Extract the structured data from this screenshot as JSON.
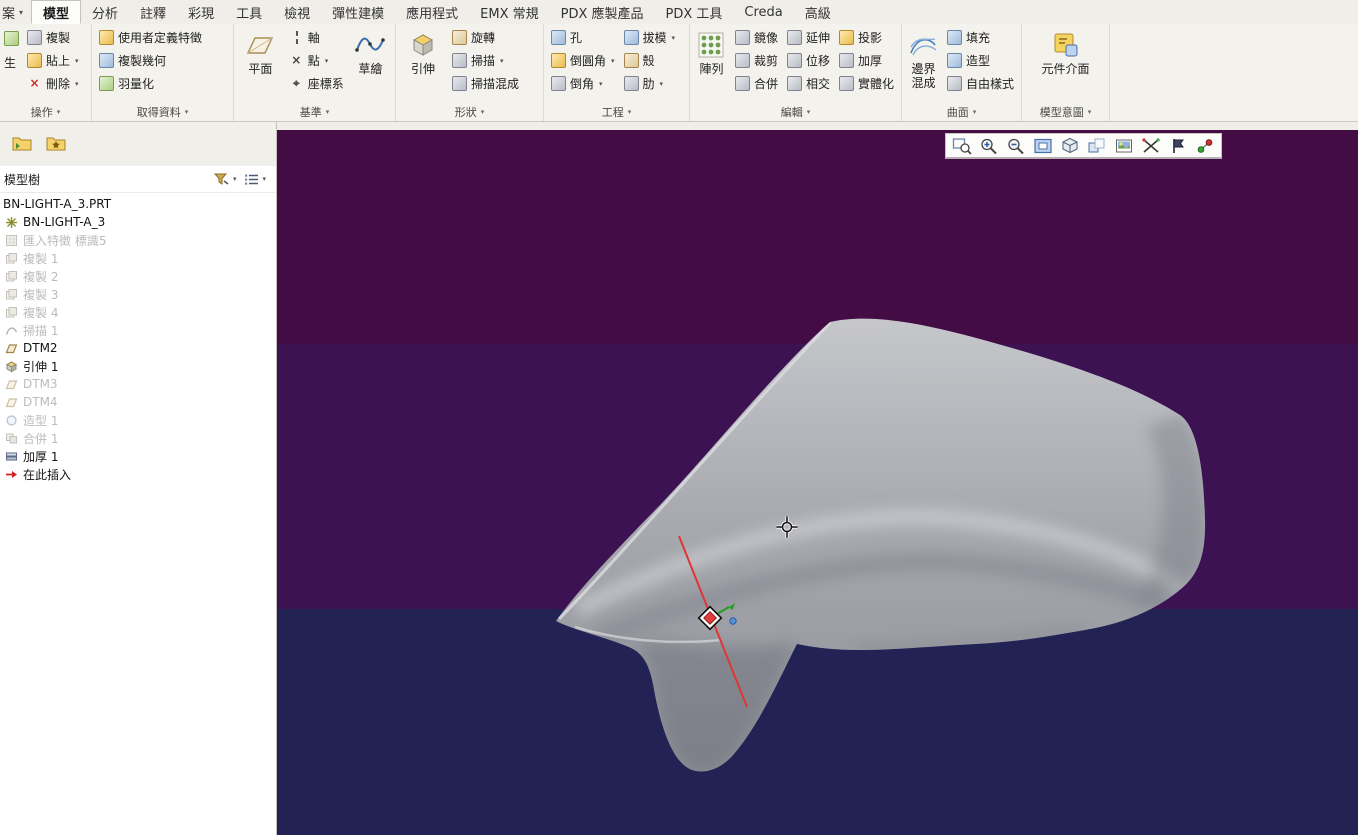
{
  "tabs": {
    "file": "案",
    "items": [
      "模型",
      "分析",
      "註釋",
      "彩現",
      "工具",
      "檢視",
      "彈性建模",
      "應用程式",
      "EMX 常規",
      "PDX 應製產品",
      "PDX 工具",
      "Creda",
      "高級"
    ],
    "selected": "模型"
  },
  "ribbon": {
    "operations": {
      "group": "操作",
      "regen_partial": "生",
      "copy": "複製",
      "paste": "貼上",
      "delete": "刪除"
    },
    "get_data": {
      "group": "取得資料",
      "udf": "使用者定義特徵",
      "copy_geometry": "複製幾何",
      "shrinkwrap": "羽量化"
    },
    "datum": {
      "group": "基準",
      "plane": "平面",
      "axis": "軸",
      "point": "點",
      "csys": "座標系",
      "sketch": "草繪"
    },
    "shapes": {
      "group": "形狀",
      "extrude": "引伸",
      "revolve": "旋轉",
      "sweep": "掃描",
      "swept_blend": "掃描混成"
    },
    "engineering": {
      "group": "工程",
      "hole": "孔",
      "round": "倒圓角",
      "chamfer": "倒角",
      "draft": "拔模",
      "shell": "殼",
      "rib": "肋"
    },
    "edit": {
      "group": "編輯",
      "pattern": "陣列",
      "mirror": "鏡像",
      "trim": "裁剪",
      "merge": "合併",
      "extend": "延伸",
      "offset": "位移",
      "intersect": "相交",
      "project": "投影",
      "thicken": "加厚",
      "solidify": "實體化"
    },
    "surfaces": {
      "group": "曲面",
      "boundary_blend": "邊界混成",
      "fill": "填充",
      "style": "造型",
      "freestyle": "自由樣式"
    },
    "model_intent": {
      "group": "模型意圖",
      "component_interface": "元件介面"
    }
  },
  "tree": {
    "title": "模型樹",
    "items": [
      {
        "label": "BN-LIGHT-A_3.PRT",
        "dim": false
      },
      {
        "label": "BN-LIGHT-A_3",
        "dim": false
      },
      {
        "label": "匯入特徵 標識5",
        "dim": true
      },
      {
        "label": "複製 1",
        "dim": true
      },
      {
        "label": "複製 2",
        "dim": true
      },
      {
        "label": "複製 3",
        "dim": true
      },
      {
        "label": "複製 4",
        "dim": true
      },
      {
        "label": "掃描 1",
        "dim": true
      },
      {
        "label": "DTM2",
        "dim": false
      },
      {
        "label": "引伸 1",
        "dim": false
      },
      {
        "label": "DTM3",
        "dim": true
      },
      {
        "label": "DTM4",
        "dim": true
      },
      {
        "label": "造型 1",
        "dim": true
      },
      {
        "label": "合併 1",
        "dim": true
      },
      {
        "label": "加厚 1",
        "dim": false
      },
      {
        "label": "在此插入",
        "dim": false
      }
    ]
  },
  "viewport": {
    "bands": {
      "top": "#440c45",
      "middle": "#3c1253",
      "bottom": "#232255"
    },
    "model_color": "#a7a9af",
    "red_accent": "#e03535",
    "toolbar_icons": [
      "zoom-region",
      "zoom-in",
      "zoom-out",
      "refit",
      "display-style",
      "saved-orientations",
      "view-images",
      "datum-display-filter",
      "annotation-display",
      "spin-center"
    ]
  }
}
